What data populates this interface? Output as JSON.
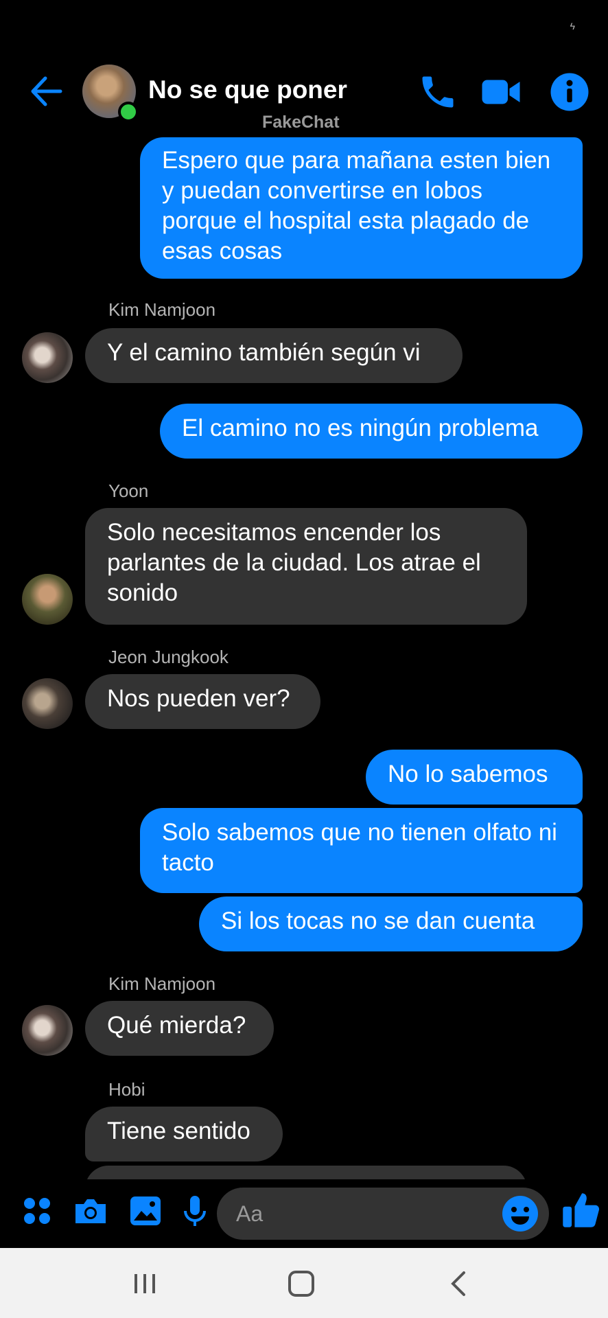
{
  "header": {
    "title": "No se que poner",
    "subtitle": "FakeChat"
  },
  "messages": [
    {
      "type": "out",
      "text": "Espero que para mañana esten bien y puedan convertirse en lobos porque el hospital esta plagado de esas cosas"
    },
    {
      "type": "sender",
      "text": "Kim Namjoon"
    },
    {
      "type": "in",
      "text": "Y el camino también según vi"
    },
    {
      "type": "out",
      "text": "El camino no es ningún problema"
    },
    {
      "type": "sender",
      "text": "Yoon"
    },
    {
      "type": "in",
      "text": "Solo necesitamos encender los parlantes de la ciudad. Los atrae el sonido"
    },
    {
      "type": "sender",
      "text": "Jeon Jungkook"
    },
    {
      "type": "in",
      "text": "Nos pueden ver?"
    },
    {
      "type": "out",
      "text": "No lo sabemos"
    },
    {
      "type": "out",
      "text": "Solo sabemos que no tienen olfato ni tacto"
    },
    {
      "type": "out",
      "text": "Si los tocas no se dan cuenta"
    },
    {
      "type": "sender",
      "text": "Kim Namjoon"
    },
    {
      "type": "in",
      "text": "Qué mierda?"
    },
    {
      "type": "sender",
      "text": "Hobi"
    },
    {
      "type": "in",
      "text": "Tiene sentido"
    }
  ],
  "composer": {
    "placeholder": "Aa",
    "icons": [
      "apps-icon",
      "camera-icon",
      "gallery-icon",
      "microphone-icon",
      "emoji-icon",
      "thumbs-up-icon"
    ]
  },
  "colors": {
    "accent": "#0a84ff",
    "incoming_bubble": "#333333",
    "background": "#000000",
    "online": "#31cc46"
  }
}
